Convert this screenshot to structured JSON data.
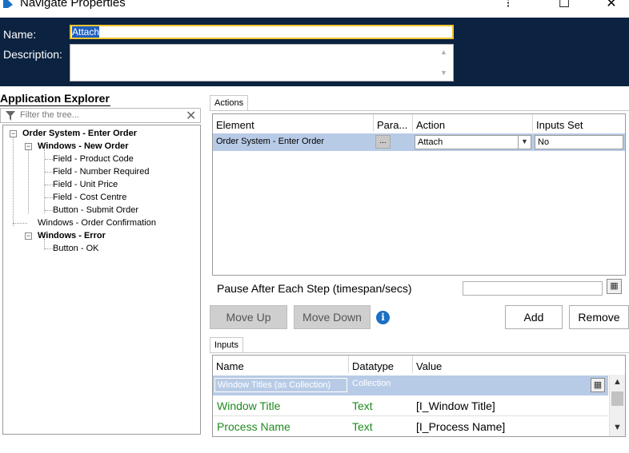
{
  "window": {
    "title": "Navigate Properties",
    "minimize_glyph": "⁝",
    "maximize_glyph": "☐",
    "close_glyph": "✕"
  },
  "header": {
    "name_label": "Name:",
    "name_value": "Attach",
    "description_label": "Description:",
    "description_value": ""
  },
  "explorer": {
    "title": "Application Explorer",
    "filter_placeholder": "Filter the tree...",
    "clear_glyph": "✕",
    "nodes": [
      {
        "label": "Order System - Enter Order"
      },
      {
        "label": "Windows - New Order"
      },
      {
        "label": "Field - Product Code"
      },
      {
        "label": "Field - Number Required"
      },
      {
        "label": "Field - Unit Price"
      },
      {
        "label": "Field - Cost Centre"
      },
      {
        "label": "Button - Submit Order"
      },
      {
        "label": "Windows - Order Confirmation"
      },
      {
        "label": "Windows - Error"
      },
      {
        "label": "Button - OK"
      }
    ]
  },
  "actions": {
    "tab_label": "Actions",
    "columns": [
      "Element",
      "Para...",
      "Action",
      "Inputs Set"
    ],
    "rows": [
      {
        "element": "Order System - Enter Order",
        "params_button": "...",
        "action": "Attach",
        "inputs_set": "No"
      }
    ],
    "pause_label": "Pause After Each Step (timespan/secs)",
    "pause_value": "",
    "move_up": "Move Up",
    "move_down": "Move Down",
    "info_glyph": "i",
    "add": "Add",
    "remove": "Remove"
  },
  "inputs": {
    "tab_label": "Inputs",
    "columns": [
      "Name",
      "Datatype",
      "Value"
    ],
    "rows": [
      {
        "name": "Window Titles (as Collection)",
        "datatype": "Collection",
        "value": ""
      },
      {
        "name": "Window Title",
        "datatype": "Text",
        "value": "[I_Window Title]"
      },
      {
        "name": "Process Name",
        "datatype": "Text",
        "value": "[I_Process Name]"
      }
    ]
  },
  "colors": {
    "header_bg": "#0b2340",
    "selection": "#b8cbe6",
    "input_text_green": "#1f8a1f",
    "focus_border": "#f4c430"
  }
}
